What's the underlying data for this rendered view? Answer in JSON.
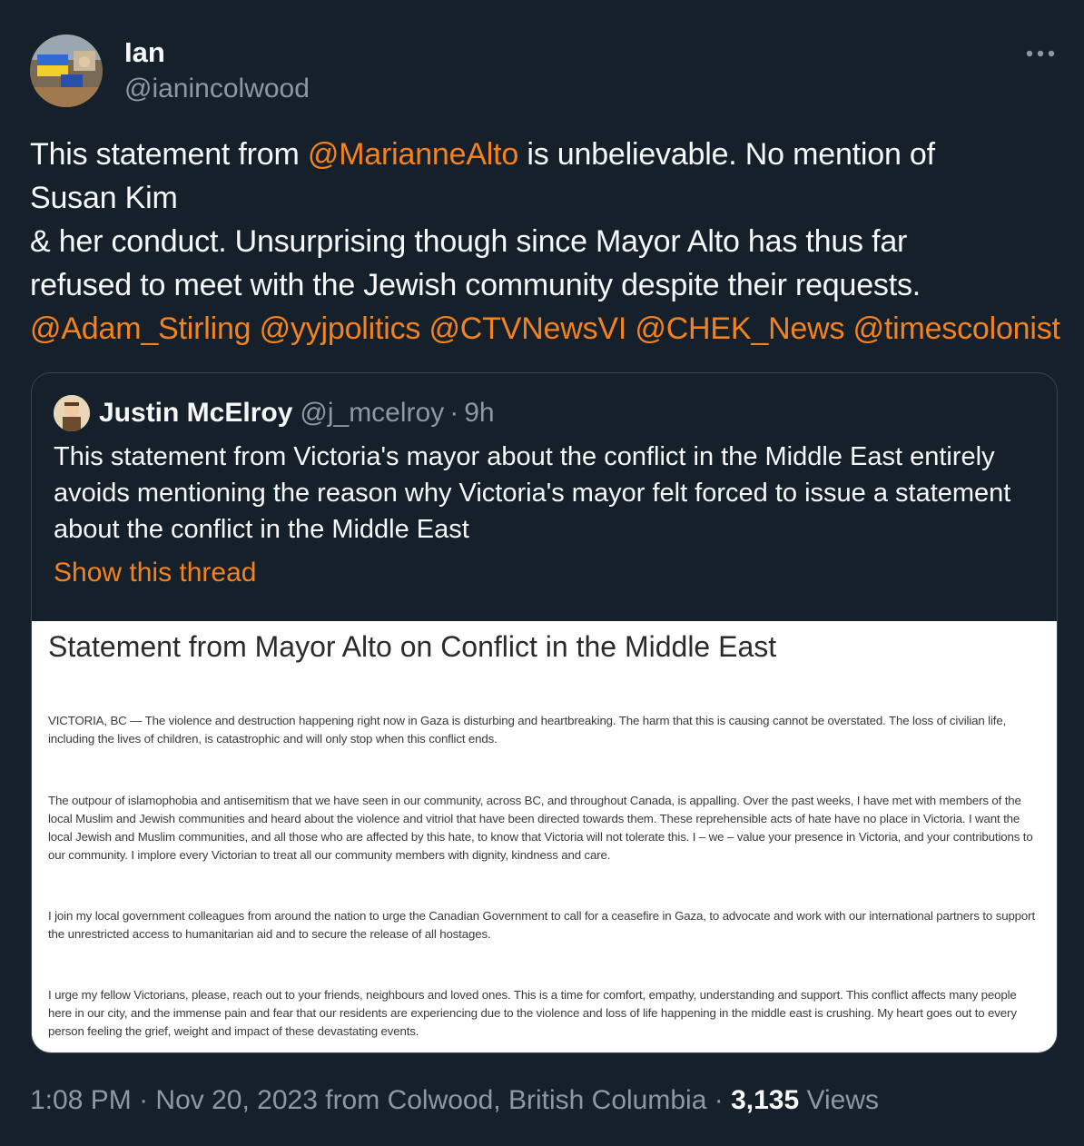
{
  "author": {
    "display_name": "Ian",
    "handle": "@ianincolwood"
  },
  "tweet": {
    "text_1": "This statement from ",
    "mention_1": "@MarianneAlto",
    "text_2": " is unbelievable. No mention of\nSusan Kim\n& her conduct. Unsurprising though since Mayor Alto has thus far\nrefused to meet with the Jewish community despite their requests.\n",
    "mentions": [
      "@Adam_Stirling",
      "@yyjpolitics",
      "@CTVNewsVI",
      "@CHEK_News",
      "@timescolonist"
    ]
  },
  "quote": {
    "display_name": "Justin McElroy",
    "handle": "@j_mcelroy",
    "time": "9h",
    "separator": "·",
    "text": "This statement from Victoria's mayor about the conflict in the Middle East entirely avoids mentioning the reason why Victoria's mayor felt forced to issue a statement about the conflict in the Middle East",
    "show_thread": "Show this thread",
    "statement": {
      "title": "Statement from Mayor Alto on Conflict in the Middle East",
      "paragraphs": [
        "VICTORIA, BC — The violence and destruction happening right now in Gaza is disturbing and heartbreaking. The harm that this is causing cannot be overstated. The loss of civilian life, including the lives of children, is catastrophic and will only stop when this conflict ends.",
        "The outpour of islamophobia and antisemitism that we have seen in our community, across BC, and throughout Canada, is appalling. Over the past weeks, I have met with members of the local Muslim and Jewish communities and heard about the violence and vitriol that have been directed towards them. These reprehensible acts of hate have no place in Victoria. I want the local Jewish and Muslim communities, and all those who are affected by this hate, to know that Victoria will not tolerate this. I – we – value your presence in Victoria, and your contributions to our community. I implore every Victorian to treat all our community members with dignity, kindness and care.",
        "I join my local government colleagues from around the nation to urge the Canadian Government to call for a ceasefire in Gaza, to advocate and work with our international partners to support the unrestricted access to humanitarian aid and to secure the release of all hostages.",
        "I urge my fellow Victorians, please, reach out to your friends, neighbours and loved ones. This is a time for comfort, empathy, understanding and support. This conflict affects many people here in our city, and the immense pain and fear that our residents are experiencing due to the violence and loss of life happening in the middle east is crushing. My heart goes out to every person feeling the grief, weight and impact of these devastating events."
      ]
    }
  },
  "footer": {
    "time": "1:08 PM",
    "date": "Nov 20, 2023",
    "location": "from Colwood, British Columbia",
    "separator": "·",
    "views_count": "3,135",
    "views_label": "Views"
  },
  "colors": {
    "background": "#15202b",
    "accent": "#f4821f",
    "muted": "#8b98a5",
    "text": "#f7f9f9",
    "border": "#38444d"
  },
  "icons": {
    "more": "more-horizontal-icon"
  }
}
